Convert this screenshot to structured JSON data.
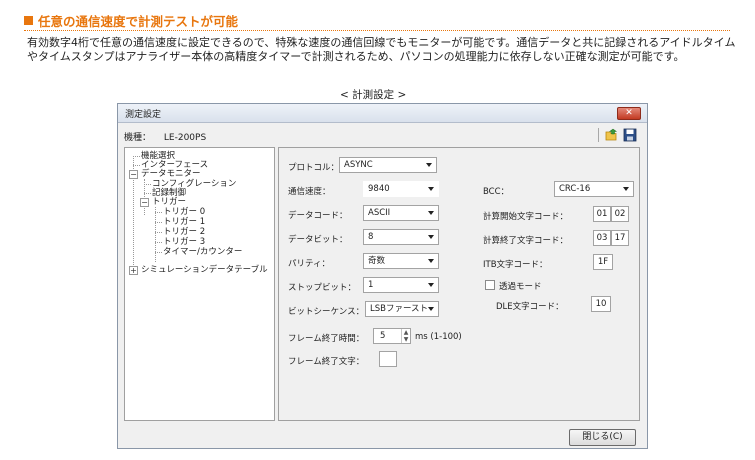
{
  "article": {
    "heading": "任意の通信速度で計測テストが可能",
    "paragraph": "有効数字4桁で任意の通信速度に設定できるので、特殊な速度の通信回線でもモニターが可能です。通信データと共に記録されるアイドルタイムやタイムスタンプはアナライザー本体の高精度タイマーで計測されるため、パソコンの処理能力に依存しない正確な測定が可能です。",
    "caption": "< 計測設定 >",
    "accent_color": "#e8760e"
  },
  "dialog": {
    "title": "測定設定",
    "close_icon": "close-x",
    "model_label": "機種：",
    "model_value": "LE-200PS",
    "toolbar_icons": [
      "folder-open-icon",
      "save-icon"
    ],
    "tree": {
      "root": "機能選択",
      "items": [
        "インターフェース",
        "データモニター",
        "コンフィグレーション",
        "記録制御",
        "トリガー",
        "トリガー 0",
        "トリガー 1",
        "トリガー 2",
        "トリガー 3",
        "タイマー/カウンター",
        "シミュレーションデータテーブル"
      ]
    },
    "settings": {
      "protocol_label": "プロトコル：",
      "protocol_value": "ASYNC",
      "baud_label": "通信速度：",
      "baud_value": "9840",
      "datacode_label": "データコード：",
      "datacode_value": "ASCII",
      "databit_label": "データビット：",
      "databit_value": "8",
      "parity_label": "パリティ：",
      "parity_value": "奇数",
      "stopbit_label": "ストップビット：",
      "stopbit_value": "1",
      "bitseq_label": "ビットシーケンス：",
      "bitseq_value": "LSBファースト",
      "frame_time_label": "フレーム終了時間：",
      "frame_time_value": "5",
      "frame_time_unit": "ms (1-100)",
      "frame_char_label": "フレーム終了文字：",
      "frame_char_value": "",
      "bcc_label": "BCC：",
      "bcc_value": "CRC-16",
      "calc_start_label": "計算開始文字コード：",
      "calc_start_1": "01",
      "calc_start_2": "02",
      "calc_end_label": "計算終了文字コード：",
      "calc_end_1": "03",
      "calc_end_2": "17",
      "itb_label": "ITB文字コード：",
      "itb_value": "1F",
      "transparent_label": "透過モード",
      "transparent_checked": false,
      "dle_label": "DLE文字コード：",
      "dle_value": "10"
    },
    "close_button": "閉じる(C)"
  }
}
